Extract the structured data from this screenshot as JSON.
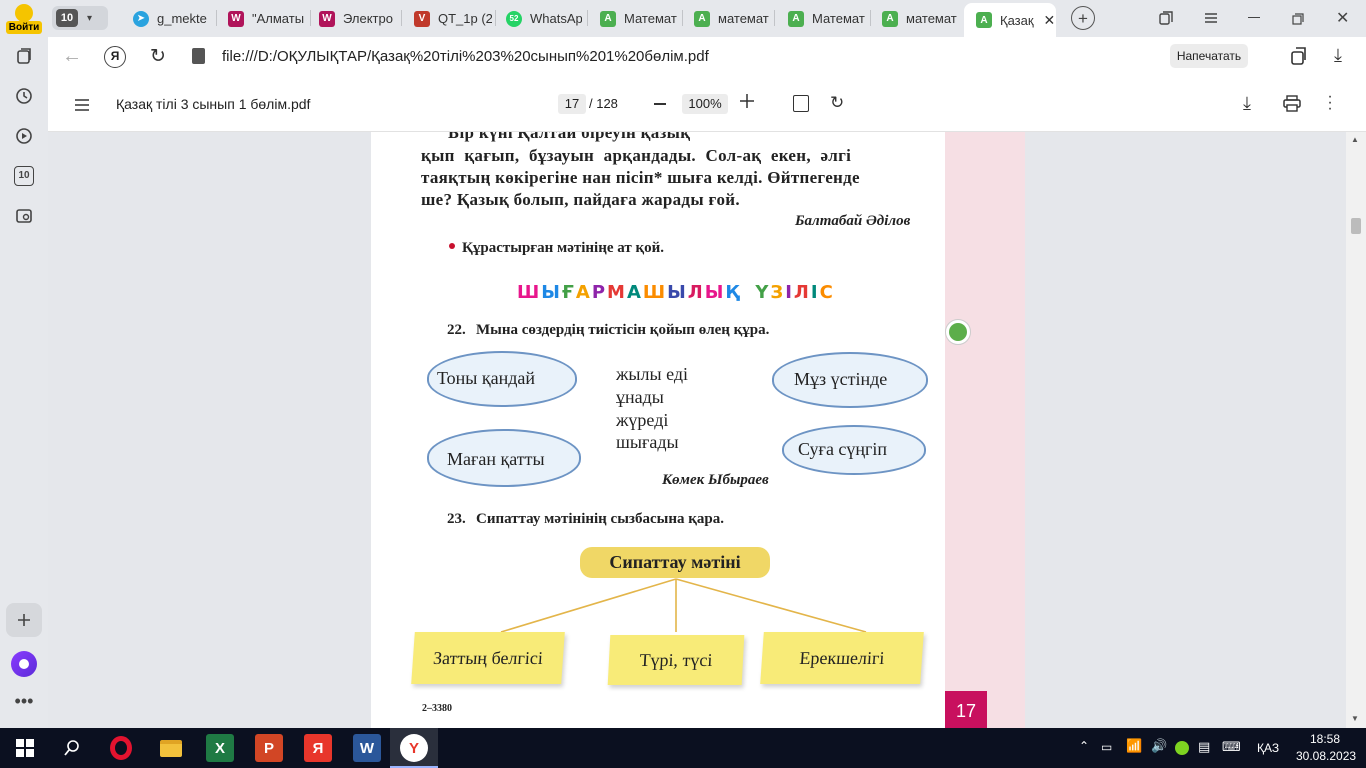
{
  "browser": {
    "profile_badge": "Войти",
    "tab_count": "10",
    "tabs": [
      {
        "label": "g_mekte",
        "color": "#2aa3df"
      },
      {
        "label": "\"Алматы",
        "color": "#b0145a"
      },
      {
        "label": "Электро",
        "color": "#b0145a"
      },
      {
        "label": "QT_1р (2",
        "color": "#c0392b"
      },
      {
        "label": "WhatsAp",
        "color": "#25d366",
        "badge": "52"
      },
      {
        "label": "Математ",
        "color": "#4caf50"
      },
      {
        "label": "математ",
        "color": "#4caf50"
      },
      {
        "label": "Математ",
        "color": "#4caf50"
      },
      {
        "label": "математ",
        "color": "#4caf50"
      },
      {
        "label": "Қазақ",
        "color": "#4caf50",
        "active": true
      }
    ],
    "address": "file:///D:/ОҚУЛЫҚТАР/Қазақ%20тілі%203%20сынып%201%20бөлім.pdf",
    "print_button": "Напечатать"
  },
  "rail": {
    "counter": "10"
  },
  "pdf": {
    "filename": "Қазақ тілі 3 сынып 1 бөлім.pdf",
    "page_current": "17",
    "page_total": "/ 128",
    "zoom": "100%"
  },
  "content": {
    "line0": "Бір күні Қалтай біреуін қазық",
    "line1": "қып қағып, бұзауын арқандады. Сол-ақ екен, әлгі",
    "line2": "таяқтың көкірегіне нан пісіп* шыға келді. Өйтпегенде",
    "line3": "ше? Қазық болып, пайдаға жарады ғой.",
    "author1": "Балтабай Әділов",
    "bullet_task": "Құрастырған мәтініңе ат қой.",
    "heading": "ШЫҒАРМАШЫЛЫҚ ҮЗІЛІС",
    "task22_num": "22.",
    "task22": "Мына сөздердің тиістісін қойып өлең құра.",
    "clouds": [
      "Тоны қандай",
      "Маған қатты",
      "Мұз үстінде",
      "Суға сүңгіп"
    ],
    "words": [
      "жылы еді",
      "ұнады",
      "жүреді",
      "шығады"
    ],
    "author2": "Көмек Ыбыраев",
    "task23_num": "23.",
    "task23": "Сипаттау мәтінінің сызбасына қара.",
    "scheme_title": "Сипаттау мәтіні",
    "scheme_items": [
      "Заттың белгісі",
      "Түрі, түсі",
      "Ерекшелігі"
    ],
    "footer_code": "2–3380",
    "page_number": "17"
  },
  "taskbar": {
    "lang": "ҚАЗ",
    "time": "18:58",
    "date": "30.08.2023"
  }
}
